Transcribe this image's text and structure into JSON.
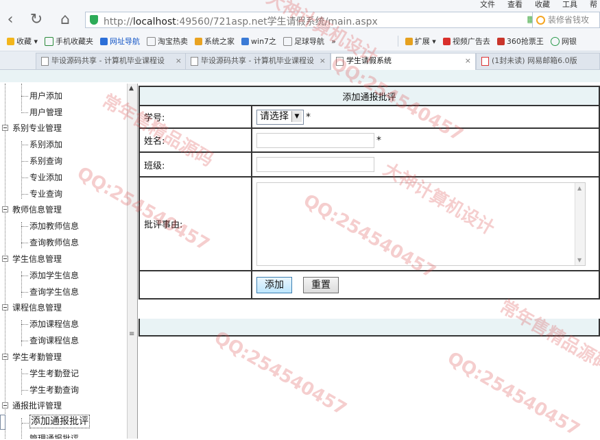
{
  "browser": {
    "menu": [
      "文件",
      "查看",
      "收藏",
      "工具",
      "帮"
    ],
    "url_prefix": "http://",
    "url_host": "localhost",
    "url_rest": ":49560/721asp.net学生请假系统/main.aspx",
    "search_placeholder": "装修省钱攻",
    "bookmarks": [
      "收藏",
      "手机收藏夹",
      "网址导航",
      "淘宝热卖",
      "系统之家",
      "win7之",
      "足球导航",
      "»"
    ],
    "bookmarks_right": [
      "扩展",
      "视频广告去",
      "360抢票王",
      "网银"
    ],
    "tabs": [
      {
        "title": "毕设源码共享 - 计算机毕业课程设",
        "close": "×"
      },
      {
        "title": "毕设源码共享 - 计算机毕业课程设",
        "close": "×"
      },
      {
        "title": "学生请假系统",
        "close": "×"
      },
      {
        "title": "(1封未读) 网易邮箱6.0版",
        "close": ""
      }
    ]
  },
  "sidebar": {
    "items": [
      {
        "label": "用户添加",
        "kind": "leaf"
      },
      {
        "label": "用户管理",
        "kind": "leaf"
      },
      {
        "label": "系别专业管理",
        "kind": "group"
      },
      {
        "label": "系别添加",
        "kind": "leaf"
      },
      {
        "label": "系别查询",
        "kind": "leaf"
      },
      {
        "label": "专业添加",
        "kind": "leaf"
      },
      {
        "label": "专业查询",
        "kind": "leaf"
      },
      {
        "label": "教师信息管理",
        "kind": "group"
      },
      {
        "label": "添加教师信息",
        "kind": "leaf"
      },
      {
        "label": "查询教师信息",
        "kind": "leaf"
      },
      {
        "label": "学生信息管理",
        "kind": "group"
      },
      {
        "label": "添加学生信息",
        "kind": "leaf"
      },
      {
        "label": "查询学生信息",
        "kind": "leaf"
      },
      {
        "label": "课程信息管理",
        "kind": "group"
      },
      {
        "label": "添加课程信息",
        "kind": "leaf"
      },
      {
        "label": "查询课程信息",
        "kind": "leaf"
      },
      {
        "label": "学生考勤管理",
        "kind": "group"
      },
      {
        "label": "学生考勤登记",
        "kind": "leaf"
      },
      {
        "label": "学生考勤查询",
        "kind": "leaf"
      },
      {
        "label": "通报批评管理",
        "kind": "group"
      },
      {
        "label": "添加通报批评",
        "kind": "leaf",
        "selected": true
      },
      {
        "label": "管理通报批评",
        "kind": "leaf"
      }
    ],
    "scroll_up": "▲",
    "scroll_grip": "≡"
  },
  "form": {
    "title": "添加通报批评",
    "student_id_label": "学号:",
    "student_id_select": "请选择",
    "name_label": "姓名:",
    "class_label": "班级:",
    "reason_label": "批评事由:",
    "required_mark": "*",
    "add_button": "添加",
    "reset_button": "重置"
  },
  "watermarks": [
    "QQ:254540457",
    "大神计算机设计",
    "常年售精品源码"
  ]
}
